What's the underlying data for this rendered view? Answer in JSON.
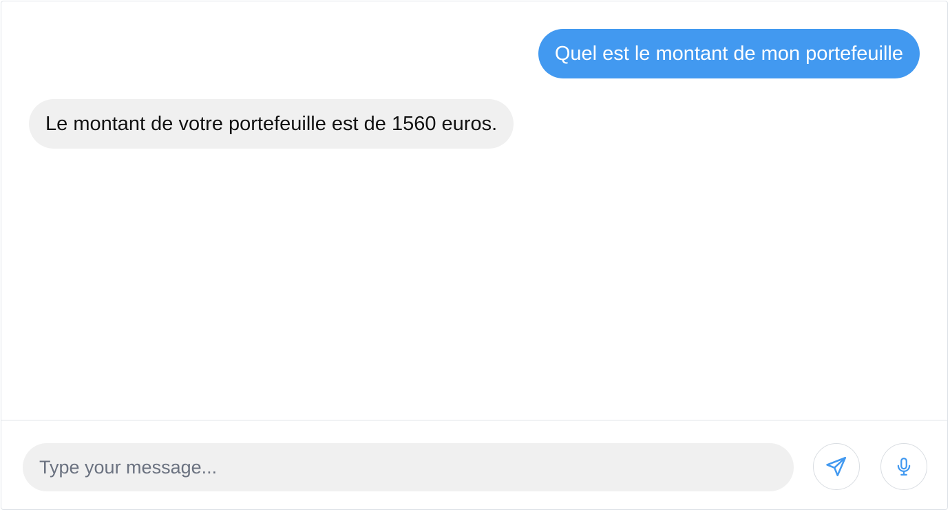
{
  "conversation": {
    "messages": [
      {
        "sender": "user",
        "text": "Quel est le montant de mon portefeuille"
      },
      {
        "sender": "bot",
        "text": "Le montant de votre portefeuille est de 1560 euros."
      }
    ]
  },
  "composer": {
    "placeholder": "Type your message...",
    "value": "",
    "send_icon": "send-icon",
    "mic_icon": "microphone-icon"
  },
  "colors": {
    "user_bubble": "#4299f0",
    "bot_bubble": "#f0f0f0",
    "accent_icon": "#4299f0"
  }
}
